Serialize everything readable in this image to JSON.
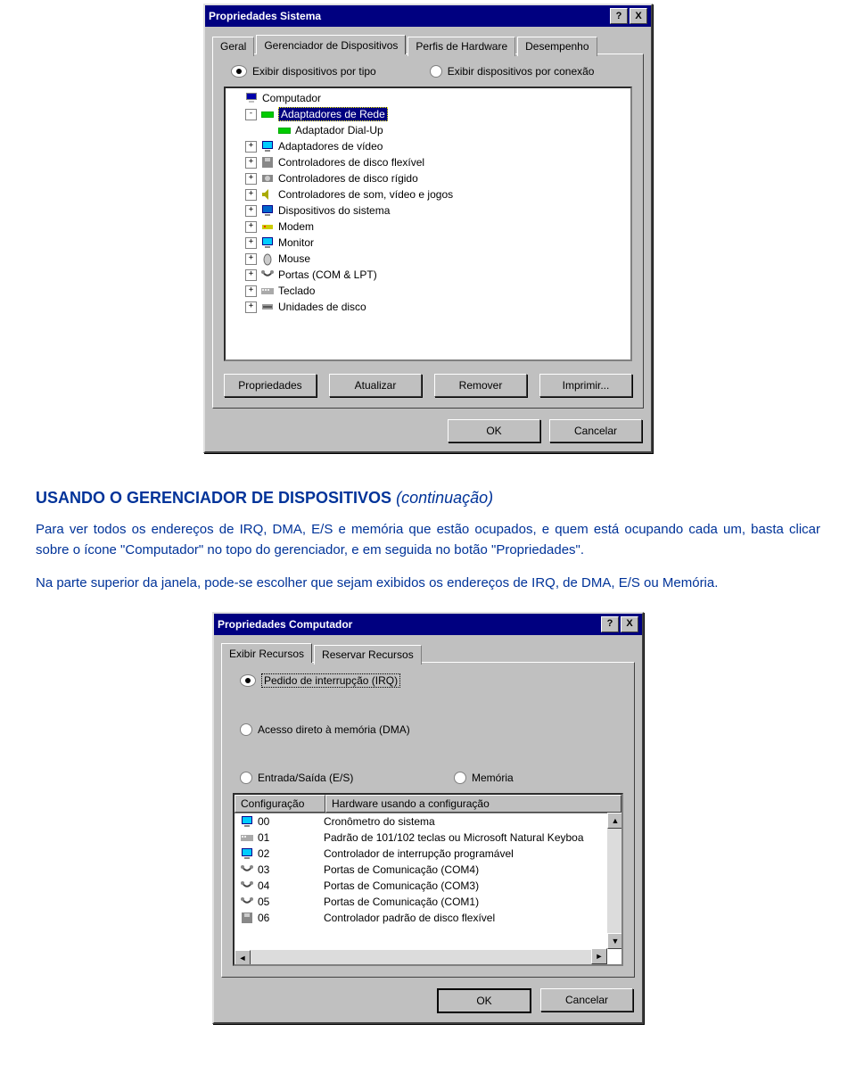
{
  "dialog1": {
    "title": "Propriedades Sistema",
    "help_btn": "?",
    "close_btn": "X",
    "tabs": {
      "geral": "Geral",
      "gerenciador": "Gerenciador de Dispositivos",
      "perfis": "Perfis de Hardware",
      "desempenho": "Desempenho"
    },
    "radios": {
      "por_tipo": "Exibir dispositivos por tipo",
      "por_conexao": "Exibir dispositivos por conexão"
    },
    "tree": {
      "root": "Computador",
      "adaptadores_rede": "Adaptadores de Rede",
      "adaptador_dialup": "Adaptador Dial-Up",
      "adaptadores_video": "Adaptadores de vídeo",
      "ctrl_disco_flex": "Controladores de disco flexível",
      "ctrl_disco_rig": "Controladores de disco rígido",
      "ctrl_som": "Controladores de som, vídeo e jogos",
      "disp_sistema": "Dispositivos do sistema",
      "modem": "Modem",
      "monitor": "Monitor",
      "mouse": "Mouse",
      "portas": "Portas (COM & LPT)",
      "teclado": "Teclado",
      "unidades_disco": "Unidades de disco"
    },
    "buttons": {
      "propriedades": "Propriedades",
      "atualizar": "Atualizar",
      "remover": "Remover",
      "imprimir": "Imprimir..."
    },
    "footer": {
      "ok": "OK",
      "cancelar": "Cancelar"
    }
  },
  "article": {
    "heading_main": "USANDO O GERENCIADOR DE DISPOSITIVOS",
    "heading_cont": "(continuação)",
    "p1": "Para ver todos os endereços de IRQ, DMA, E/S e memória que estão ocupados, e quem está ocupando cada um, basta clicar sobre o ícone \"Computador\" no topo do gerenciador, e em seguida no botão \"Propriedades\".",
    "p2": "Na parte superior da janela, pode-se escolher que sejam exibidos os endereços de IRQ, de DMA, E/S ou Memória."
  },
  "dialog2": {
    "title": "Propriedades Computador",
    "help_btn": "?",
    "close_btn": "X",
    "tabs": {
      "exibir": "Exibir Recursos",
      "reservar": "Reservar Recursos"
    },
    "radios": {
      "irq": "Pedido de interrupção (IRQ)",
      "dma": "Acesso direto à memória (DMA)",
      "es": "Entrada/Saída (E/S)",
      "mem": "Memória"
    },
    "headers": {
      "config": "Configuração",
      "hw": "Hardware usando a configuração"
    },
    "rows": [
      {
        "cfg": "00",
        "hw": "Cronômetro do sistema"
      },
      {
        "cfg": "01",
        "hw": "Padrão de 101/102 teclas ou Microsoft Natural Keyboa"
      },
      {
        "cfg": "02",
        "hw": "Controlador de interrupção programável"
      },
      {
        "cfg": "03",
        "hw": "Portas de Comunicação (COM4)"
      },
      {
        "cfg": "04",
        "hw": "Portas de Comunicação (COM3)"
      },
      {
        "cfg": "05",
        "hw": "Portas de Comunicação (COM1)"
      },
      {
        "cfg": "06",
        "hw": "Controlador padrão de disco flexível"
      }
    ],
    "footer": {
      "ok": "OK",
      "cancelar": "Cancelar"
    }
  }
}
